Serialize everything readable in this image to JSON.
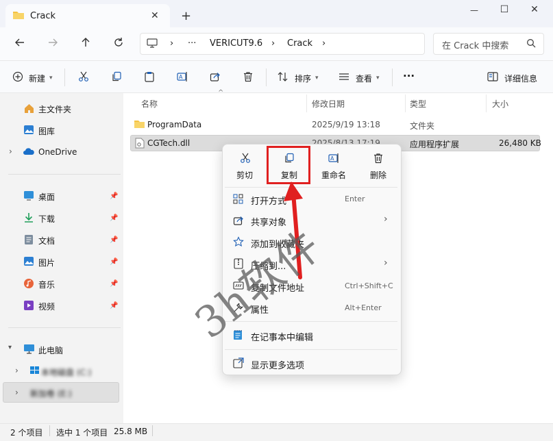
{
  "window": {
    "tab_title": "Crack",
    "new_tab": "+",
    "tab_close": "✕",
    "controls": {
      "minimize": "—",
      "maximize": "☐",
      "close": "✕"
    }
  },
  "address": {
    "more": "···",
    "crumbs": [
      "VERICUT9.6",
      "Crack"
    ],
    "search_placeholder": "在 Crack 中搜索"
  },
  "toolbar": {
    "new_label": "新建",
    "sort_label": "排序",
    "view_label": "查看",
    "more": "···",
    "details_label": "详细信息"
  },
  "sidebar": {
    "top_items": [
      {
        "label": "主文件夹",
        "icon": "home-icon"
      },
      {
        "label": "图库",
        "icon": "gallery-icon"
      },
      {
        "label": "OneDrive",
        "icon": "onedrive-icon"
      }
    ],
    "pinned_items": [
      {
        "label": "桌面",
        "icon": "desktop-icon",
        "color": "#2f8fd8"
      },
      {
        "label": "下载",
        "icon": "download-icon",
        "color": "#1f9e5a"
      },
      {
        "label": "文档",
        "icon": "document-icon",
        "color": "#6a7c8e"
      },
      {
        "label": "图片",
        "icon": "picture-icon",
        "color": "#2c7fd2"
      },
      {
        "label": "音乐",
        "icon": "music-icon",
        "color": "#e8643a"
      },
      {
        "label": "视频",
        "icon": "video-icon",
        "color": "#7a3fc2"
      }
    ],
    "this_pc": "此电脑",
    "drives": [
      "本地磁盘 (C:)",
      "新加卷 (E:)"
    ]
  },
  "columns": [
    "名称",
    "修改日期",
    "类型",
    "大小"
  ],
  "files": [
    {
      "name": "ProgramData",
      "date": "2025/9/19 13:18",
      "type": "文件夹",
      "size": ""
    },
    {
      "name": "CGTech.dll",
      "date": "2025/8/13 17:19",
      "type": "应用程序扩展",
      "size": "26,480 KB"
    }
  ],
  "status": {
    "count": "2 个项目",
    "selected": "选中 1 个项目",
    "size": "25.8 MB"
  },
  "context_menu": {
    "top_actions": [
      "剪切",
      "复制",
      "重命名",
      "删除"
    ],
    "items": [
      {
        "label": "打开方式",
        "shortcut": "Enter",
        "icon": "open-with-icon"
      },
      {
        "label": "共享对象",
        "shortcut": "",
        "icon": "share-icon",
        "submenu": true
      },
      {
        "label": "添加到收藏夹",
        "shortcut": "",
        "icon": "star-icon"
      },
      {
        "label": "压缩到...",
        "shortcut": "",
        "icon": "zip-icon",
        "submenu": true
      },
      {
        "label": "复制文件地址",
        "shortcut": "Ctrl+Shift+C",
        "icon": "copy-path-icon"
      },
      {
        "label": "属性",
        "shortcut": "Alt+Enter",
        "icon": "properties-icon"
      },
      {
        "label": "在记事本中编辑",
        "shortcut": "",
        "icon": "notepad-icon"
      },
      {
        "label": "显示更多选项",
        "shortcut": "",
        "icon": "more-options-icon"
      }
    ]
  },
  "watermark": "3h软件",
  "colors": {
    "highlight": "#e02020",
    "accent": "#0067c0",
    "folder": "#f4c242"
  }
}
